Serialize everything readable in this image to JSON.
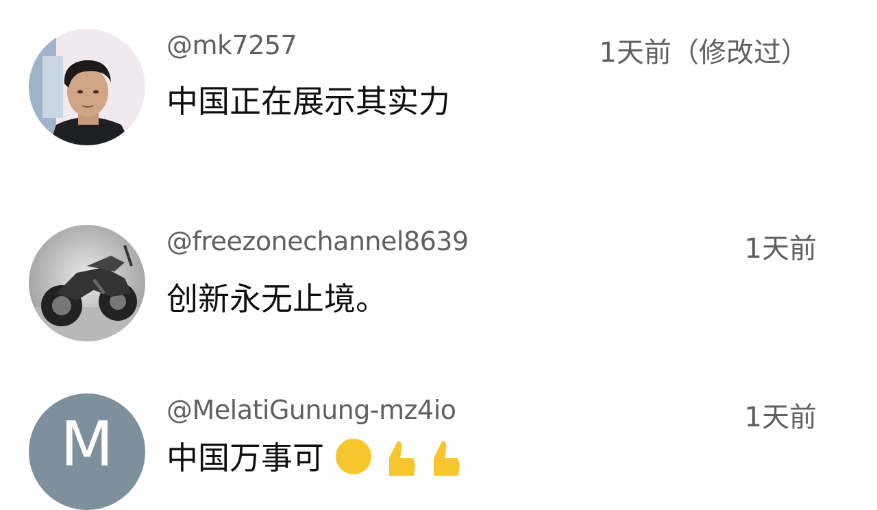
{
  "comments": [
    {
      "handle": "@mk7257",
      "time": "1天前（修改过）",
      "text": "中国正在展示其实力",
      "avatar_icon": "person-photo-avatar"
    },
    {
      "handle": "@freezonechannel8639",
      "time": "1天前",
      "text": "创新永无止境。",
      "avatar_icon": "motorcycle-photo-avatar"
    },
    {
      "handle": "@MelatiGunung-mz4io",
      "time": "1天前",
      "text": "中国万事可",
      "avatar_letter": "M",
      "avatar_color": "#7d909b"
    }
  ]
}
